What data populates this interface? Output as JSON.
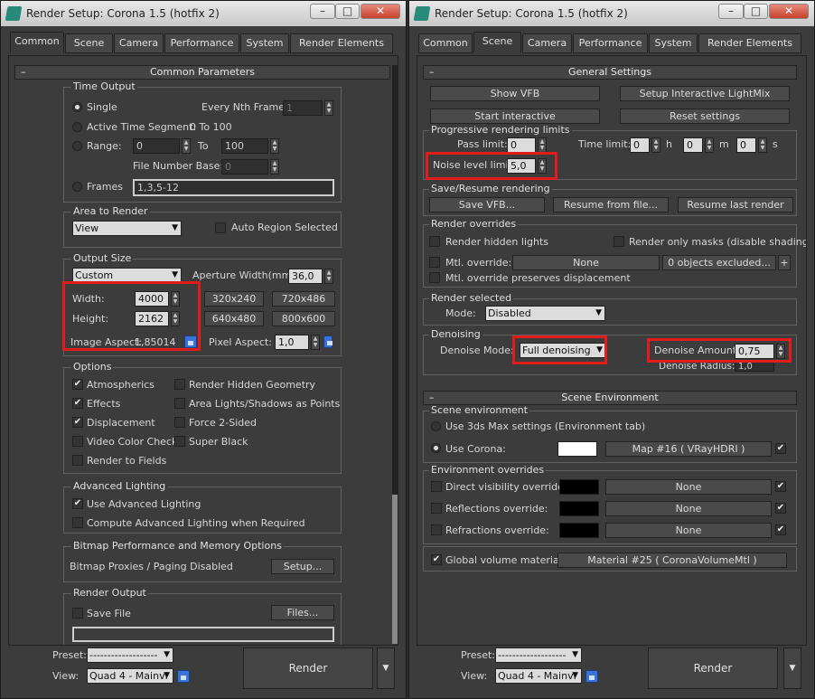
{
  "left": {
    "title": "Render Setup: Corona 1.5 (hotfix 2)",
    "tabs": [
      "Common",
      "Scene",
      "Camera",
      "Performance",
      "System",
      "Render Elements"
    ],
    "rollout": "Common Parameters",
    "time_output": {
      "title": "Time Output",
      "single": "Single",
      "every_nth": "Every Nth Frame:",
      "every_nth_value": "1",
      "active_segment": "Active Time Segment:",
      "active_range": "0 To 100",
      "range": "Range:",
      "range_from": "0",
      "to": "To",
      "range_to": "100",
      "file_number_base": "File Number Base:",
      "file_number_value": "0",
      "frames": "Frames",
      "frames_value": "1,3,5-12"
    },
    "area": {
      "title": "Area to Render",
      "value": "View",
      "auto_region": "Auto Region Selected"
    },
    "output_size": {
      "title": "Output Size",
      "preset": "Custom",
      "aperture_label": "Aperture Width(mm):",
      "aperture_value": "36,0",
      "width_label": "Width:",
      "width_value": "4000",
      "height_label": "Height:",
      "height_value": "2162",
      "presets": [
        "320x240",
        "720x486",
        "640x480",
        "800x600"
      ],
      "image_aspect": "Image Aspect:",
      "image_aspect_value": "1,85014",
      "pixel_aspect": "Pixel Aspect:",
      "pixel_aspect_value": "1,0"
    },
    "options": {
      "title": "Options",
      "items": [
        {
          "label": "Atmospherics",
          "checked": true
        },
        {
          "label": "Render Hidden Geometry",
          "checked": false
        },
        {
          "label": "Effects",
          "checked": true
        },
        {
          "label": "Area Lights/Shadows as Points",
          "checked": false
        },
        {
          "label": "Displacement",
          "checked": true
        },
        {
          "label": "Force 2-Sided",
          "checked": false
        },
        {
          "label": "Video Color Check",
          "checked": false
        },
        {
          "label": "Super Black",
          "checked": false
        },
        {
          "label": "Render to Fields",
          "checked": false
        }
      ]
    },
    "advanced_lighting": {
      "title": "Advanced Lighting",
      "use": "Use Advanced Lighting",
      "compute": "Compute Advanced Lighting when Required"
    },
    "bitmap": {
      "title": "Bitmap Performance and Memory Options",
      "status": "Bitmap Proxies / Paging Disabled",
      "setup": "Setup..."
    },
    "render_output": {
      "title": "Render Output",
      "save_file": "Save File",
      "files": "Files..."
    },
    "bottom": {
      "preset_label": "Preset:",
      "preset_value": "-------------------",
      "view_label": "View:",
      "view_value": "Quad 4 - Mainvi",
      "render": "Render"
    }
  },
  "right": {
    "title": "Render Setup: Corona 1.5 (hotfix 2)",
    "tabs": [
      "Common",
      "Scene",
      "Camera",
      "Performance",
      "System",
      "Render Elements"
    ],
    "rollout1": "General Settings",
    "show_vfb": "Show VFB",
    "setup_lightmix": "Setup Interactive LightMix",
    "start_interactive": "Start interactive",
    "reset_settings": "Reset settings",
    "progressive": {
      "title": "Progressive rendering limits",
      "pass_limit": "Pass limit:",
      "pass_value": "0",
      "time_limit": "Time limit:",
      "h_value": "0",
      "h": "h",
      "m_value": "0",
      "m": "m",
      "s_value": "0",
      "s": "s",
      "noise_label": "Noise level limit:",
      "noise_value": "5,0"
    },
    "save_resume": {
      "title": "Save/Resume rendering",
      "save_vfb": "Save VFB...",
      "resume_file": "Resume from file...",
      "resume_last": "Resume last render"
    },
    "overrides": {
      "title": "Render overrides",
      "hidden_lights": "Render hidden lights",
      "only_masks": "Render only masks (disable shading)",
      "mtl_override": "Mtl. override:",
      "mtl_value": "None",
      "excluded": "0 objects excluded...",
      "plus": "+",
      "preserves": "Mtl. override preserves displacement"
    },
    "render_selected": {
      "title": "Render selected",
      "mode_label": "Mode:",
      "mode_value": "Disabled"
    },
    "denoising": {
      "title": "Denoising",
      "mode_label": "Denoise Mode:",
      "mode_value": "Full denoising",
      "amount_label": "Denoise Amount:",
      "amount_value": "0,75",
      "radius_label": "Denoise Radius:",
      "radius_value": "1,0"
    },
    "rollout2": "Scene Environment",
    "scene_env": {
      "title": "Scene environment",
      "use_max": "Use 3ds Max settings (Environment tab)",
      "use_corona": "Use Corona:",
      "map": "Map #16  ( VRayHDRI )"
    },
    "env_overrides": {
      "title": "Environment overrides",
      "rows": [
        {
          "label": "Direct visibility override:",
          "value": "None"
        },
        {
          "label": "Reflections override:",
          "value": "None"
        },
        {
          "label": "Refractions override:",
          "value": "None"
        }
      ],
      "global_volume": "Global volume material:",
      "global_volume_value": "Material #25  ( CoronaVolumeMtl )"
    },
    "bottom": {
      "preset_label": "Preset:",
      "preset_value": "-------------------",
      "view_label": "View:",
      "view_value": "Quad 4 - Mainvi",
      "render": "Render"
    }
  },
  "colors": {
    "highlight_red": "#e21b1b",
    "lock_blue": "#3a73d8"
  }
}
